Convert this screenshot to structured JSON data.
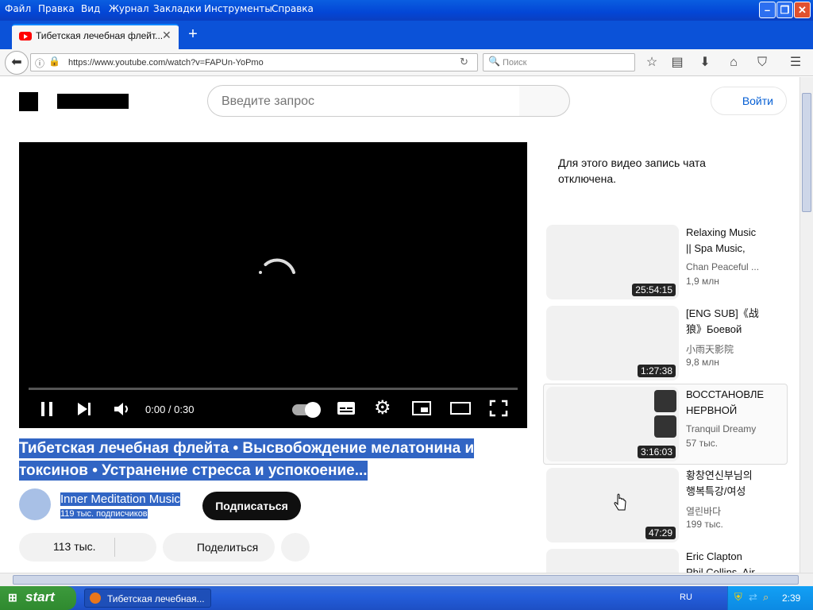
{
  "menu": [
    "Файл",
    "Правка",
    "Вид",
    "Журнал",
    "Закладки",
    "Инструменты",
    "Справка"
  ],
  "tab": {
    "title": "Тибетская лечебная флейт..."
  },
  "address": {
    "url": "https://www.youtube.com/watch?v=FAPUn-YoPmo",
    "search_placeholder": "Поиск"
  },
  "yt": {
    "search_placeholder": "Введите запрос",
    "signin": "Войти",
    "player_time": "0:00 / 0:30",
    "title": "Тибетская лечебная флейта • Высвобождение мелатонина и токсинов • Устранение стресса и успокоение...",
    "channel": "Inner Meditation Music",
    "subs": "119 тыс. подписчиков",
    "subscribe": "Подписаться",
    "likes": "113 тыс.",
    "share": "Поделиться",
    "chat": "Для этого видео запись чата отключена."
  },
  "related": [
    {
      "t1": "Relaxing Music",
      "t2": "|| Spa Music,",
      "ch": "Chan Peaceful ...",
      "views": "1,9 млн",
      "dur": "25:54:15"
    },
    {
      "t1": "[ENG SUB]《战",
      "t2": "狼》Боевой",
      "ch": "小雨天影院",
      "views": "9,8 млн",
      "dur": "1:27:38"
    },
    {
      "t1": "ВОССТАНОВЛЕ",
      "t2": "НЕРВНОЙ",
      "ch": "Tranquil Dreamy",
      "views": "57 тыс.",
      "dur": "3:16:03"
    },
    {
      "t1": "황창연신부님의",
      "t2": "행복특강/여성",
      "ch": "열린바다",
      "views": "199 тыс.",
      "dur": "47:29"
    },
    {
      "t1": "Eric Clapton",
      "t2": "Phil Collins, Air"
    }
  ],
  "taskbar": {
    "start": "start",
    "task": "Тибетская лечебная...",
    "lang": "RU",
    "clock": "2:39"
  },
  "colors": {
    "xp_blue": "#0346d6",
    "selection": "#3165c4",
    "subscribe_bg": "#0f0f0f"
  }
}
